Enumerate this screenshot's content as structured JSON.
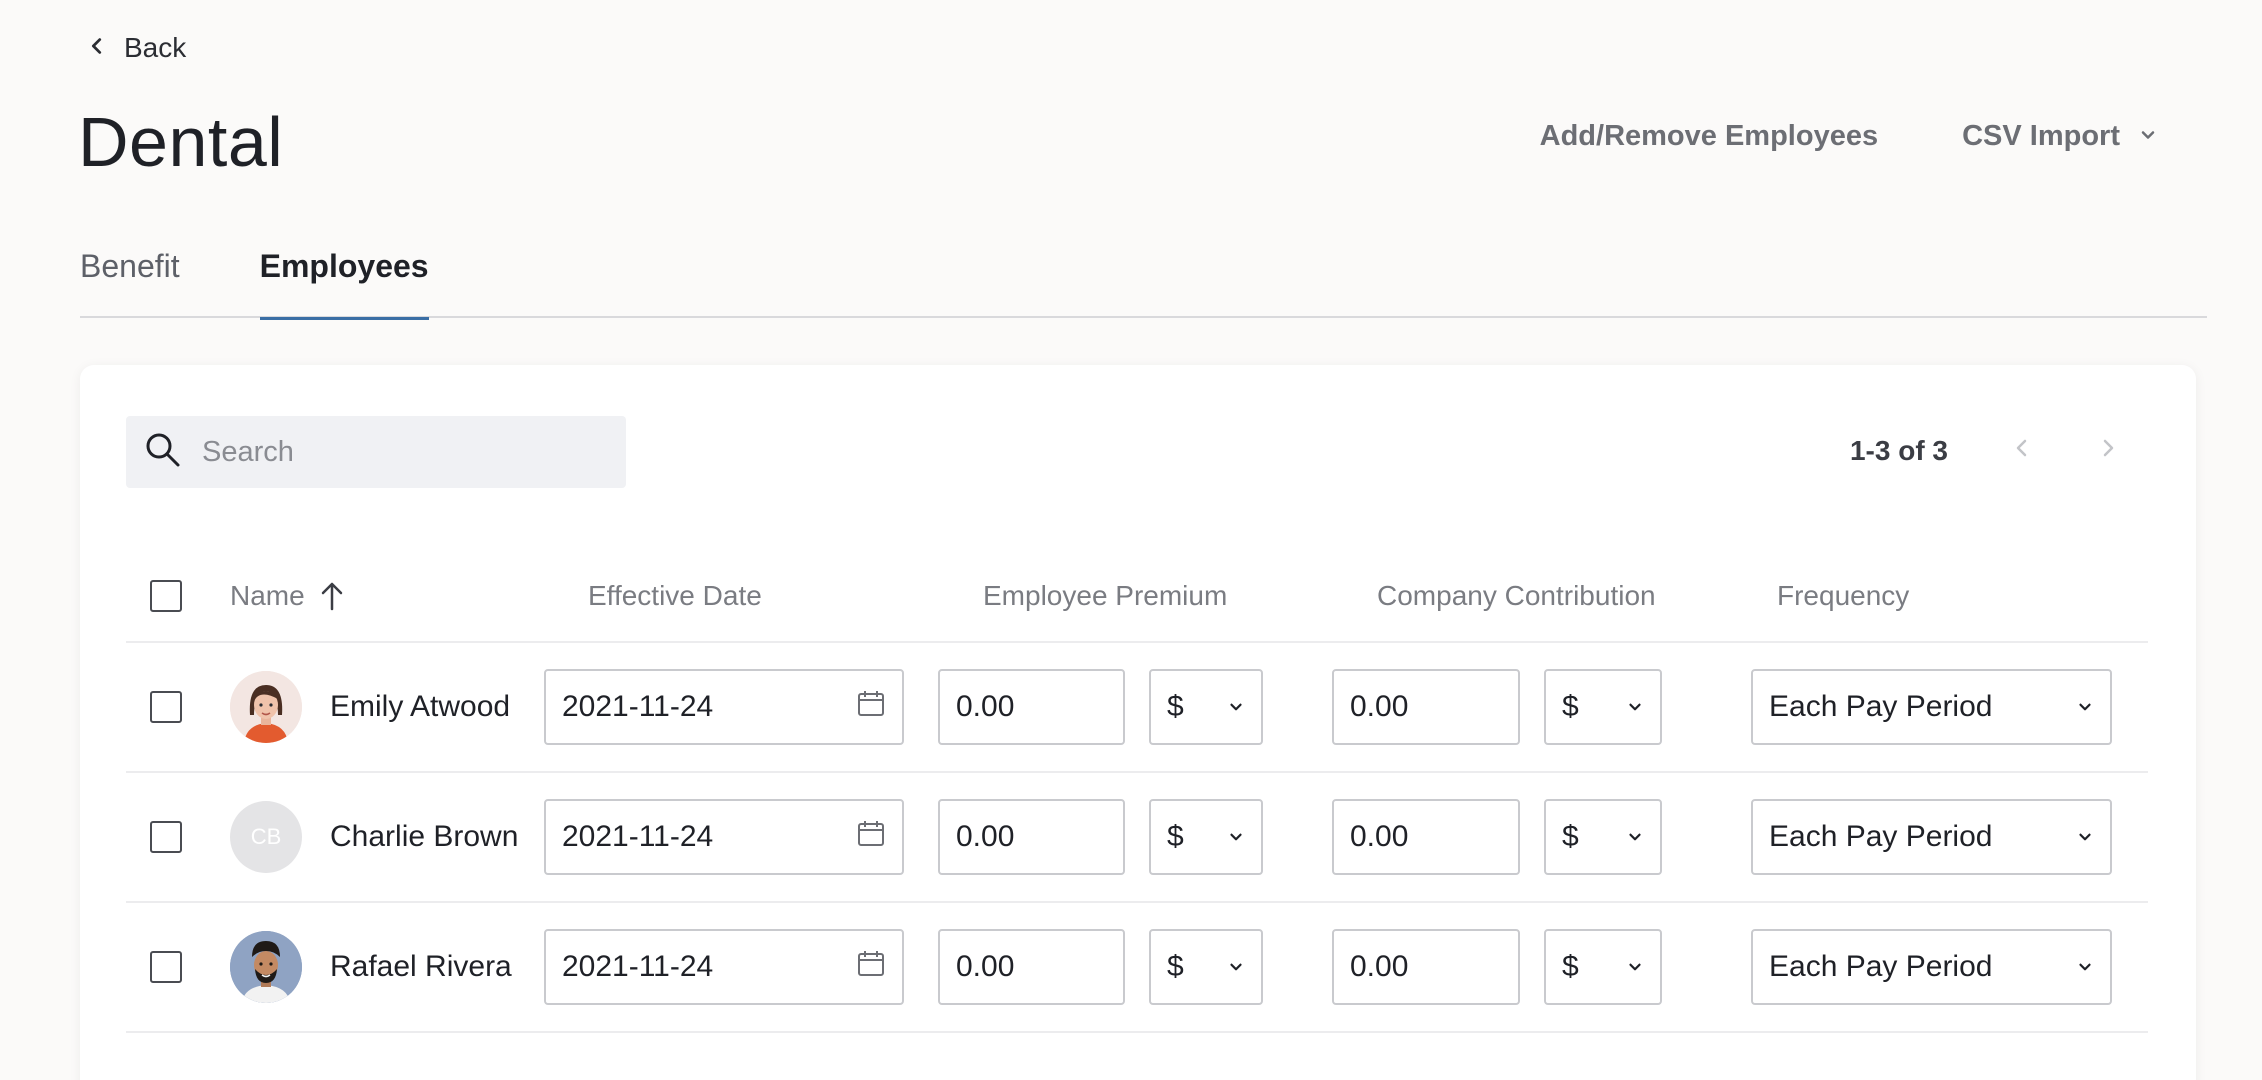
{
  "nav": {
    "back_label": "Back"
  },
  "page": {
    "title": "Dental"
  },
  "header_actions": {
    "add_remove": "Add/Remove Employees",
    "csv_import": "CSV Import"
  },
  "tabs": [
    {
      "label": "Benefit",
      "active": false
    },
    {
      "label": "Employees",
      "active": true
    }
  ],
  "search": {
    "placeholder": "Search",
    "value": ""
  },
  "pagination": {
    "range": "1-3 of 3"
  },
  "table": {
    "columns": [
      "Name",
      "Effective Date",
      "Employee Premium",
      "Company Contribution",
      "Frequency"
    ],
    "rows": [
      {
        "name": "Emily Atwood",
        "initials": "",
        "avatar": "photo-woman",
        "effective_date": "2021-11-24",
        "premium": "0.00",
        "premium_unit": "$",
        "contribution": "0.00",
        "contribution_unit": "$",
        "frequency": "Each Pay Period"
      },
      {
        "name": "Charlie Brown",
        "initials": "CB",
        "avatar": "initials",
        "effective_date": "2021-11-24",
        "premium": "0.00",
        "premium_unit": "$",
        "contribution": "0.00",
        "contribution_unit": "$",
        "frequency": "Each Pay Period"
      },
      {
        "name": "Rafael Rivera",
        "initials": "",
        "avatar": "photo-man",
        "effective_date": "2021-11-24",
        "premium": "0.00",
        "premium_unit": "$",
        "contribution": "0.00",
        "contribution_unit": "$",
        "frequency": "Each Pay Period"
      }
    ]
  },
  "colors": {
    "accent": "#3a6ea5",
    "background": "#fbfaf9"
  }
}
